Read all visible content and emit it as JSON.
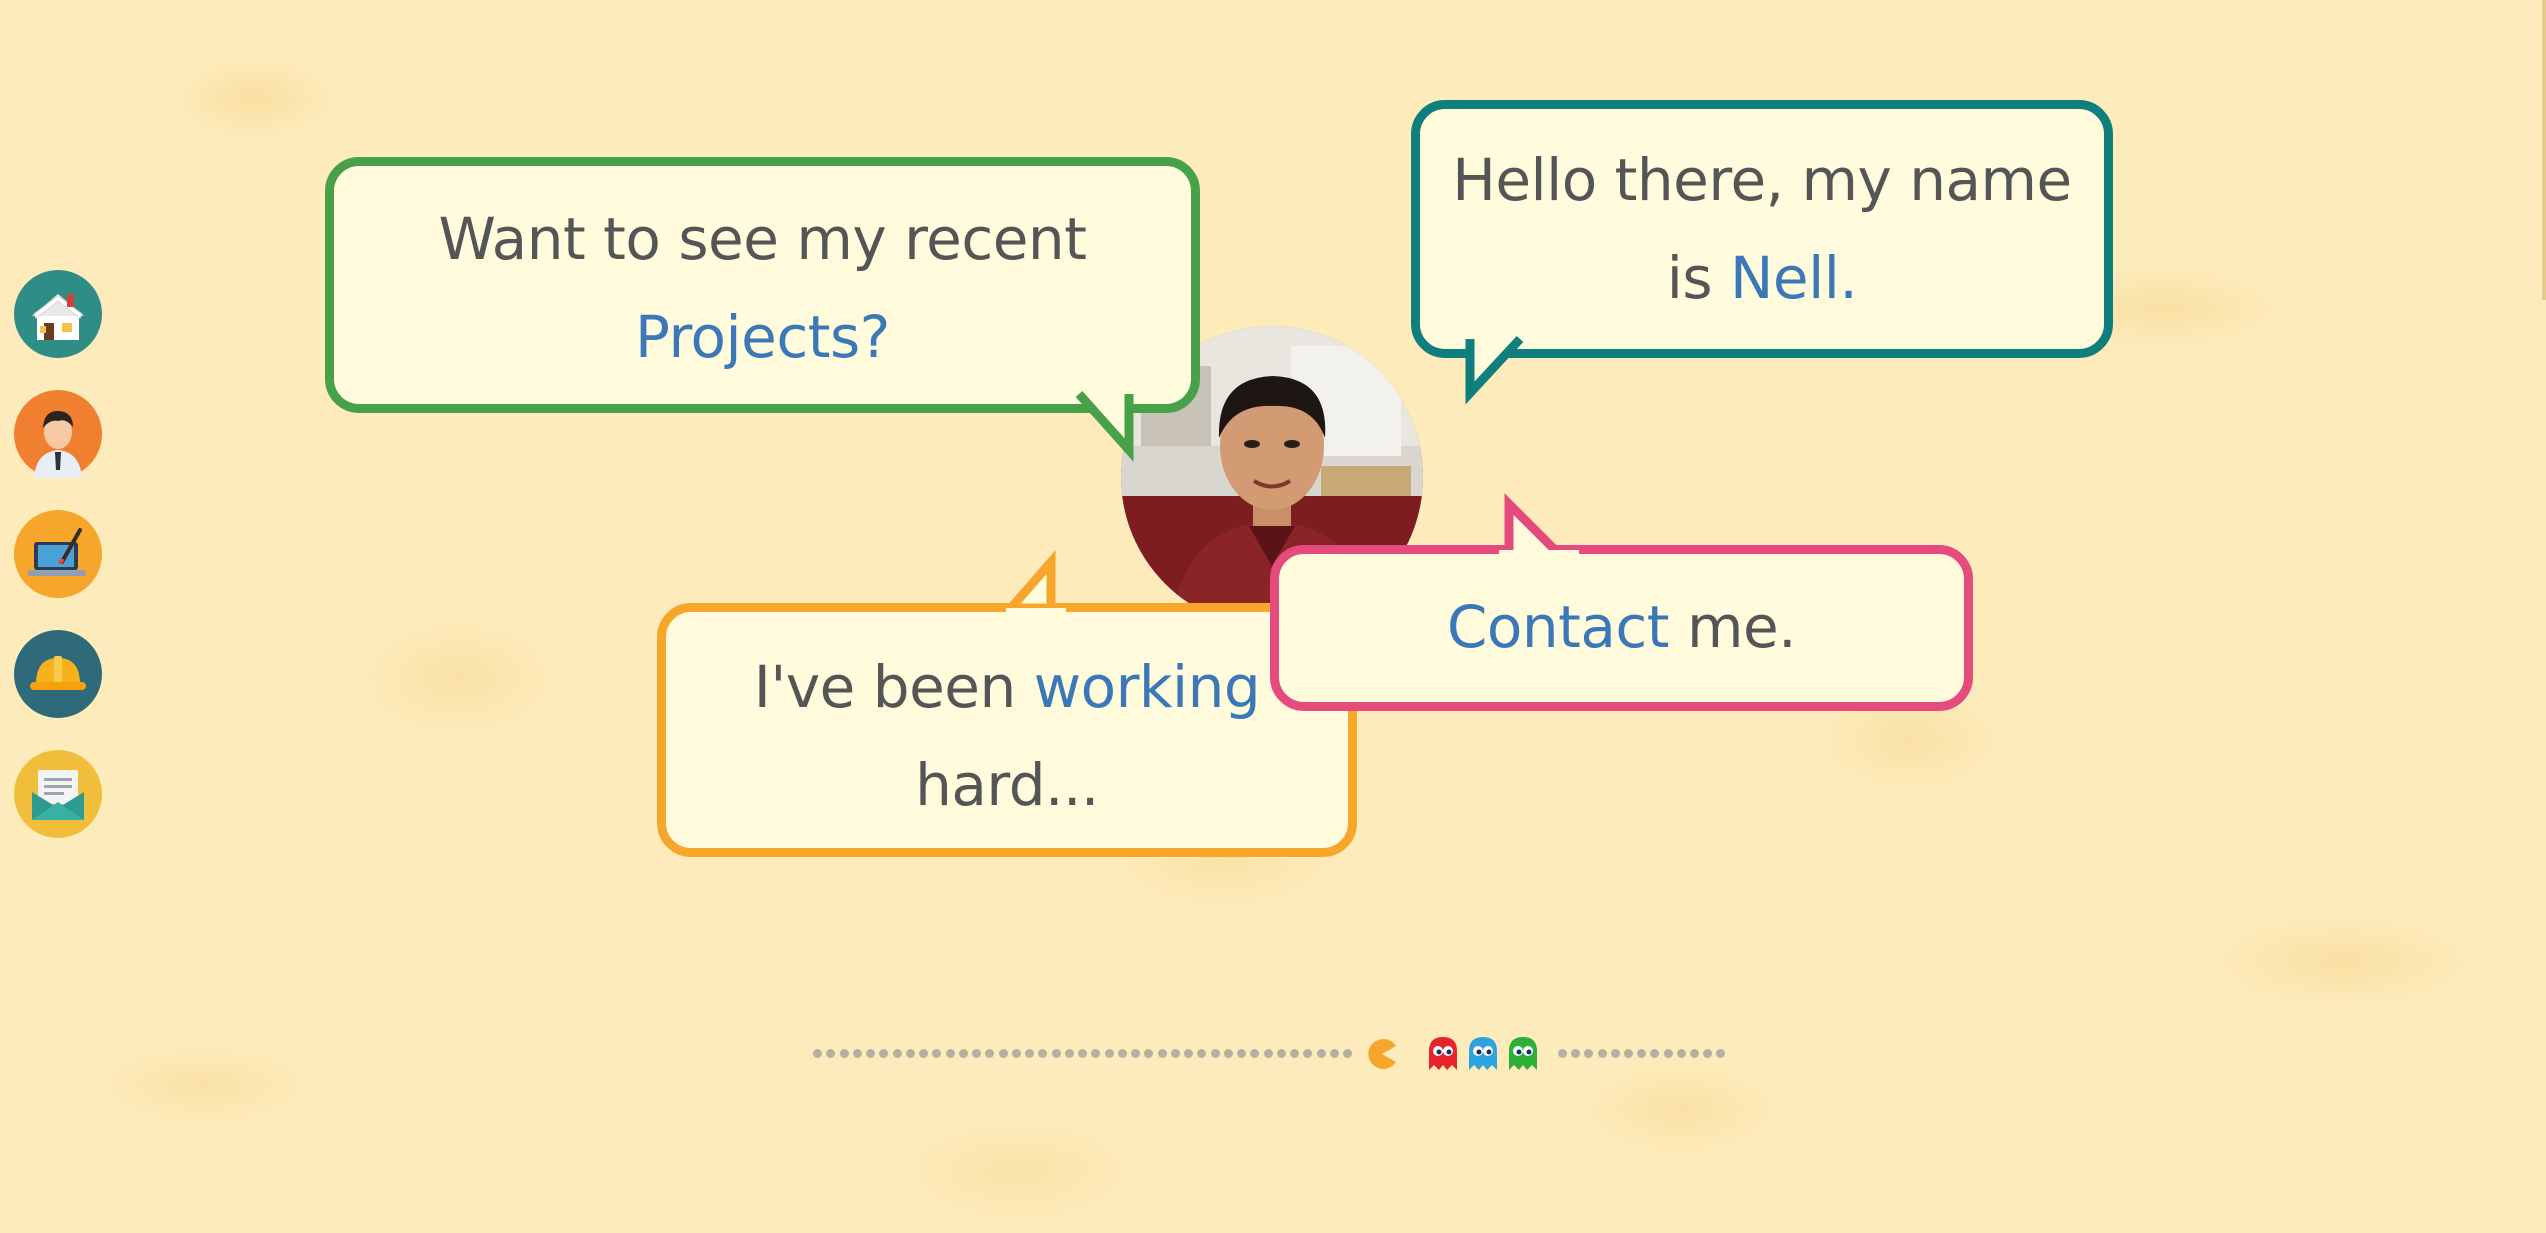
{
  "nav": [
    {
      "name": "home",
      "icon": "house-icon",
      "color": "#2e8e86"
    },
    {
      "name": "about",
      "icon": "person-avatar-icon",
      "color": "#f07f2f"
    },
    {
      "name": "projects",
      "icon": "laptop-brush-icon",
      "color": "#f6a72b"
    },
    {
      "name": "work",
      "icon": "hard-hat-icon",
      "color": "#2f6a7a"
    },
    {
      "name": "contact",
      "icon": "envelope-icon",
      "color": "#f0be3a"
    }
  ],
  "bubbles": {
    "projects": {
      "line1": "Want to see my recent",
      "link": "Projects?"
    },
    "hello": {
      "line1": "Hello there, my name",
      "prefix": "is",
      "link": "Nell."
    },
    "working": {
      "prefix": "I've been",
      "link": "working",
      "line2": "hard..."
    },
    "contact": {
      "link": "Contact",
      "suffix": " me."
    }
  },
  "progress": {
    "value": 0.6,
    "pacman_color": "#f6a72b",
    "ghost_colors": [
      "#e5252a",
      "#2ea3e0",
      "#2db035"
    ]
  },
  "colors": {
    "background": "#fdebbb",
    "link": "#3a78b8",
    "text": "#555555"
  }
}
